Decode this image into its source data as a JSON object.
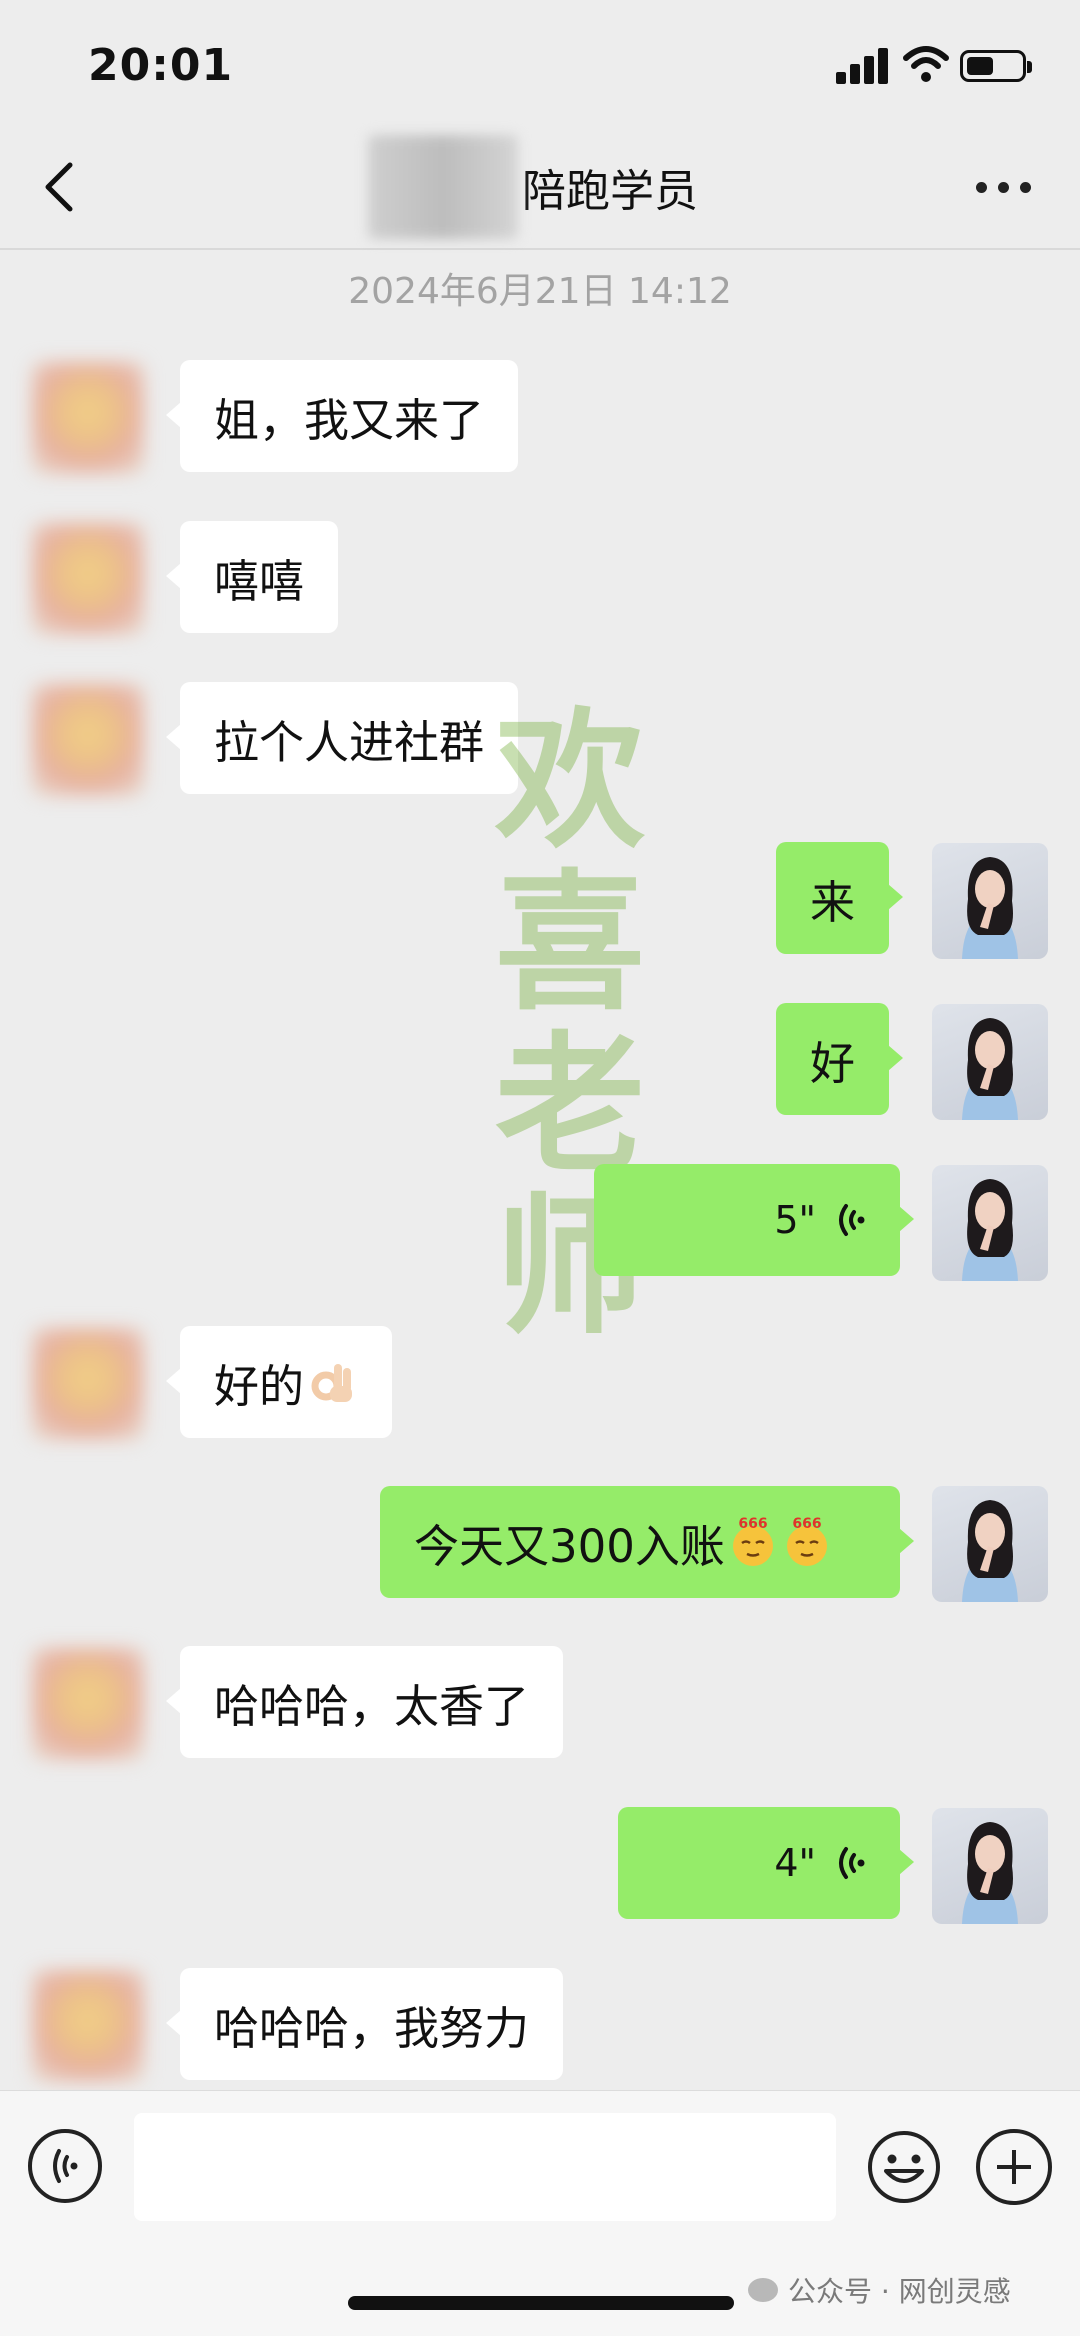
{
  "status_bar": {
    "time": "20:01"
  },
  "header": {
    "title": "陪跑学员"
  },
  "timestamp": "2024年6月21日 14:12",
  "messages": [
    {
      "side": "in",
      "text": "姐，我又来了"
    },
    {
      "side": "in",
      "text": "嘻嘻"
    },
    {
      "side": "in",
      "text": "拉个人进社群"
    },
    {
      "side": "out",
      "text": "来"
    },
    {
      "side": "out",
      "text": "好"
    },
    {
      "side": "out",
      "type": "voice",
      "duration": "5\""
    },
    {
      "side": "in",
      "text": "好的",
      "emoji": "ok-hand-icon"
    },
    {
      "side": "out",
      "text": "今天又300入账",
      "emoji": "666-face-icon"
    },
    {
      "side": "in",
      "text": "哈哈哈，太香了"
    },
    {
      "side": "out",
      "type": "voice",
      "duration": "4\""
    },
    {
      "side": "in",
      "text": "哈哈哈，我努力"
    }
  ],
  "watermark": [
    "欢",
    "喜",
    "老",
    "师"
  ],
  "source_mark": "公众号 · 网创灵感",
  "colors": {
    "out_bubble": "#95ec69",
    "in_bubble": "#ffffff",
    "background": "#ededed"
  }
}
